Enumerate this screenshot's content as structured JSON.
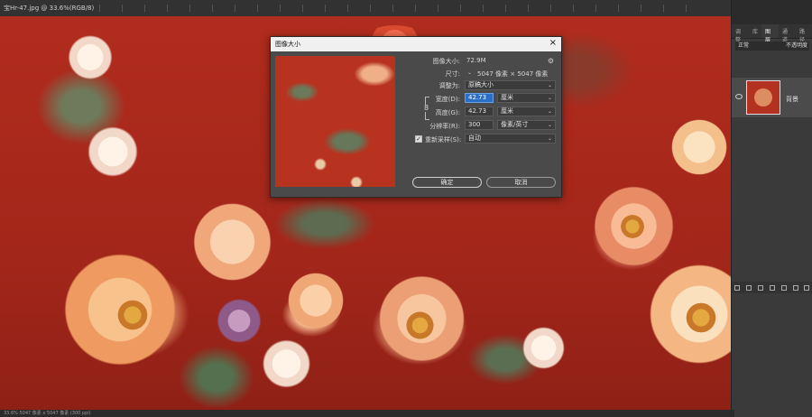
{
  "app": {
    "document_tab": "宝Hr-47.jpg @ 33.6%(RGB/8)",
    "status": "33.6% 5047 像素 x 5047 像素 (300 ppi)"
  },
  "dialog": {
    "title": "图像大小",
    "image_size_label": "图像大小:",
    "image_size_value": "72.9M",
    "dimensions_label": "尺寸:",
    "dimensions_value": "5047 像素 × 5047 像素",
    "fit_label": "调整为:",
    "fit_value": "原稿大小",
    "width_label": "宽度(D):",
    "width_value": "42.73",
    "width_unit": "厘米",
    "height_label": "高度(G):",
    "height_value": "42.73",
    "height_unit": "厘米",
    "resolution_label": "分辨率(R):",
    "resolution_value": "300",
    "resolution_unit": "像素/英寸",
    "resample_label": "重新采样(S):",
    "resample_checked": true,
    "resample_value": "自动",
    "ok_label": "确定",
    "cancel_label": "取消"
  },
  "layers_panel": {
    "tabs": [
      "调整",
      "库",
      "图层",
      "通道",
      "路径"
    ],
    "active_tab": "图层",
    "blend_mode": "正常",
    "opacity_label": "不透明度",
    "layer_name": "背景"
  },
  "colors": {
    "canvas_red": "#a52a1f",
    "panel_bg": "#3a3a3a",
    "dialog_bg": "#4a4a4a",
    "highlight_blue": "#2b6ec8"
  }
}
